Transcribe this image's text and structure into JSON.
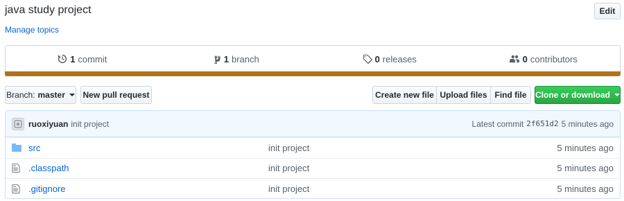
{
  "repo": {
    "description": "java study project",
    "edit_label": "Edit",
    "manage_topics": "Manage topics"
  },
  "summary": {
    "commits_count": "1",
    "commits_label": "commit",
    "branches_count": "1",
    "branches_label": "branch",
    "releases_count": "0",
    "releases_label": "releases",
    "contributors_count": "0",
    "contributors_label": "contributors",
    "language_color": "#b07219"
  },
  "toolbar": {
    "branch_prefix": "Branch:",
    "branch_name": "master",
    "new_pr": "New pull request",
    "create_file": "Create new file",
    "upload_files": "Upload files",
    "find_file": "Find file",
    "clone": "Clone or download"
  },
  "commit": {
    "author": "ruoxiyuan",
    "message": "init project",
    "latest_label": "Latest commit",
    "sha": "2f651d2",
    "age": "5 minutes ago"
  },
  "files": [
    {
      "name": "src",
      "type": "folder",
      "message": "init project",
      "age": "5 minutes ago",
      "icon": "folder-icon"
    },
    {
      "name": ".classpath",
      "type": "file",
      "message": "init project",
      "age": "5 minutes ago",
      "icon": "file-icon"
    },
    {
      "name": ".gitignore",
      "type": "file",
      "message": "init project",
      "age": "5 minutes ago",
      "icon": "file-icon"
    }
  ]
}
